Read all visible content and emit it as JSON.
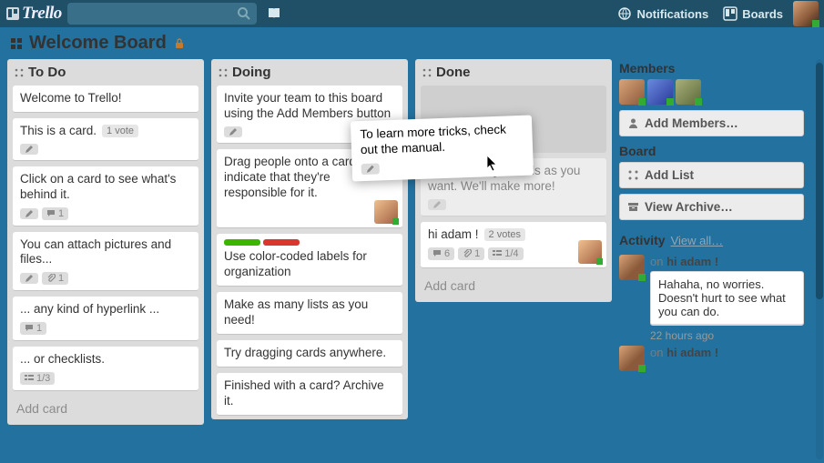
{
  "header": {
    "logo_text": "Trello",
    "notifications_label": "Notifications",
    "boards_label": "Boards",
    "search_placeholder": ""
  },
  "board": {
    "title": "Welcome Board"
  },
  "lists": [
    {
      "name": "To Do",
      "cards": [
        {
          "title": "Welcome to Trello!",
          "badges": []
        },
        {
          "title": "This is a card.",
          "vote_text": "1 vote",
          "badges": [
            {
              "type": "edit"
            }
          ]
        },
        {
          "title": "Click on a card to see what's behind it.",
          "badges": [
            {
              "type": "edit"
            },
            {
              "type": "comments",
              "value": "1"
            }
          ]
        },
        {
          "title": "You can attach pictures and files...",
          "badges": [
            {
              "type": "edit"
            },
            {
              "type": "attach",
              "value": "1"
            }
          ]
        },
        {
          "title": "... any kind of hyperlink ...",
          "badges": [
            {
              "type": "comments",
              "value": "1"
            }
          ]
        },
        {
          "title": "... or checklists.",
          "badges": [
            {
              "type": "checklist",
              "value": "1/3"
            }
          ]
        }
      ],
      "add_card_label": "Add card"
    },
    {
      "name": "Doing",
      "cards": [
        {
          "title": "Invite your team to this board using the Add Members button",
          "badges": [
            {
              "type": "edit"
            }
          ]
        },
        {
          "title": "Drag people onto a card to indicate that they're responsible for it.",
          "badges": [],
          "member": true
        },
        {
          "title": "Use color-coded labels for organization",
          "labels": [
            "#3cb500",
            "#d9362e"
          ],
          "badges": []
        },
        {
          "title": "Make as many lists as you need!",
          "badges": []
        },
        {
          "title": "Try dragging cards anywhere.",
          "badges": []
        },
        {
          "title": "Finished with a card? Archive it.",
          "badges": []
        }
      ],
      "add_card_label": "Add card"
    },
    {
      "name": "Done",
      "cards": [
        {
          "title": "Use as many boards as you want. We'll make more!",
          "badges": [
            {
              "type": "edit"
            }
          ],
          "behind": true
        },
        {
          "title": "hi adam !",
          "vote_text": "2 votes",
          "badges": [
            {
              "type": "comments",
              "value": "6"
            },
            {
              "type": "attach",
              "value": "1"
            },
            {
              "type": "checklist",
              "value": "1/4"
            }
          ],
          "member": true
        }
      ],
      "add_card_label": "Add card"
    }
  ],
  "tooltip_card": {
    "title": "To learn more tricks, check out the manual.",
    "badges": [
      {
        "type": "edit"
      }
    ]
  },
  "sidebar": {
    "members_heading": "Members",
    "member_colors": [
      "#d9a47a",
      "#3b5fe0",
      "#7a8a5a"
    ],
    "add_members_label": "Add Members…",
    "board_heading": "Board",
    "add_list_label": "Add List",
    "view_archive_label": "View Archive…",
    "activity_heading": "Activity",
    "view_all_label": "View all…",
    "activity": [
      {
        "prefix": "on",
        "target": "hi adam !",
        "comment": "Hahaha, no worries. Doesn't hurt to see what you can do.",
        "time": "22 hours ago"
      },
      {
        "prefix": "on",
        "target": "hi adam !"
      }
    ]
  }
}
